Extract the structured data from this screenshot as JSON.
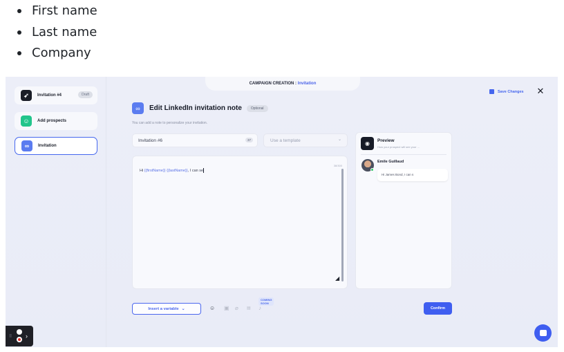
{
  "bullets": [
    "First name",
    "Last name",
    "Company"
  ],
  "campaign_tab": {
    "label": "CAMPAIGN CREATION :",
    "active": "Invitation"
  },
  "header": {
    "save_changes": "Save Changes",
    "close_icon": "close-icon"
  },
  "steps": [
    {
      "label": "Invitation #4",
      "badge": "Draft",
      "icon": "rocket-icon",
      "color": "#1a1d27"
    },
    {
      "label": "Add prospects",
      "icon": "person-icon",
      "color": "#22c58b"
    },
    {
      "label": "Invitation",
      "icon": "link-icon",
      "color": "#5b7cf0",
      "active": true
    }
  ],
  "editor_section": {
    "title": "Edit LinkedIn invitation note",
    "optional_badge": "Optional",
    "subtitle": "You can add a note to personalize your invitation.",
    "name_value": "Invitation #6",
    "name_count": "37",
    "template_placeholder": "Use a template",
    "message_prefix": "Hi ",
    "var_first": "{{firstName}}",
    "var_last": "{{lastName}}",
    "message_suffix": ", I can se",
    "char_count": "38/300"
  },
  "preview": {
    "title": "Preview",
    "subtitle": "How your prospect will see your ...",
    "prospect_name": "Emile Guillaud",
    "message": "Hi James Bond, I can s"
  },
  "toolbar": {
    "insert_variable": "Insert a variable",
    "coming_soon": "COMING SOON",
    "confirm": "Confirm"
  }
}
